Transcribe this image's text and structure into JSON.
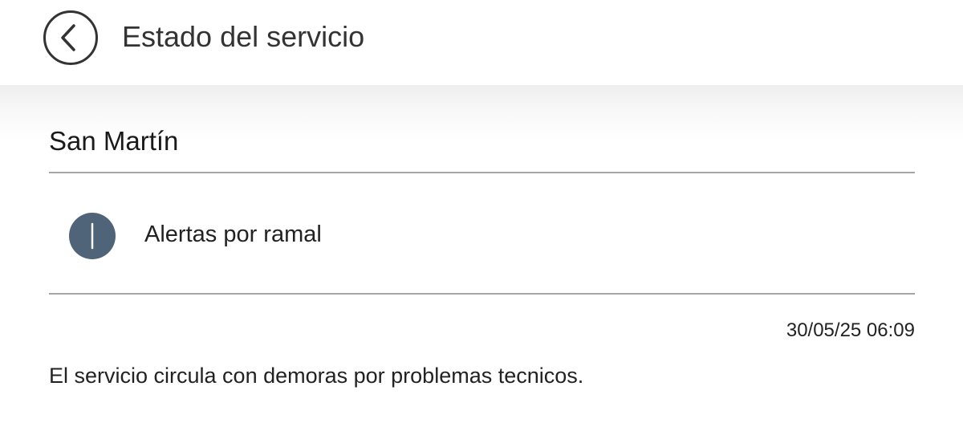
{
  "header": {
    "title": "Estado del servicio",
    "back_icon": "chevron-left-circle-icon"
  },
  "line": {
    "name": "San Martín"
  },
  "alerts": {
    "label": "Alertas por ramal",
    "icon": "info-icon",
    "icon_color": "#4f6478"
  },
  "notice": {
    "timestamp": "30/05/25 06:09",
    "message": "El servicio circula con demoras por problemas tecnicos."
  }
}
